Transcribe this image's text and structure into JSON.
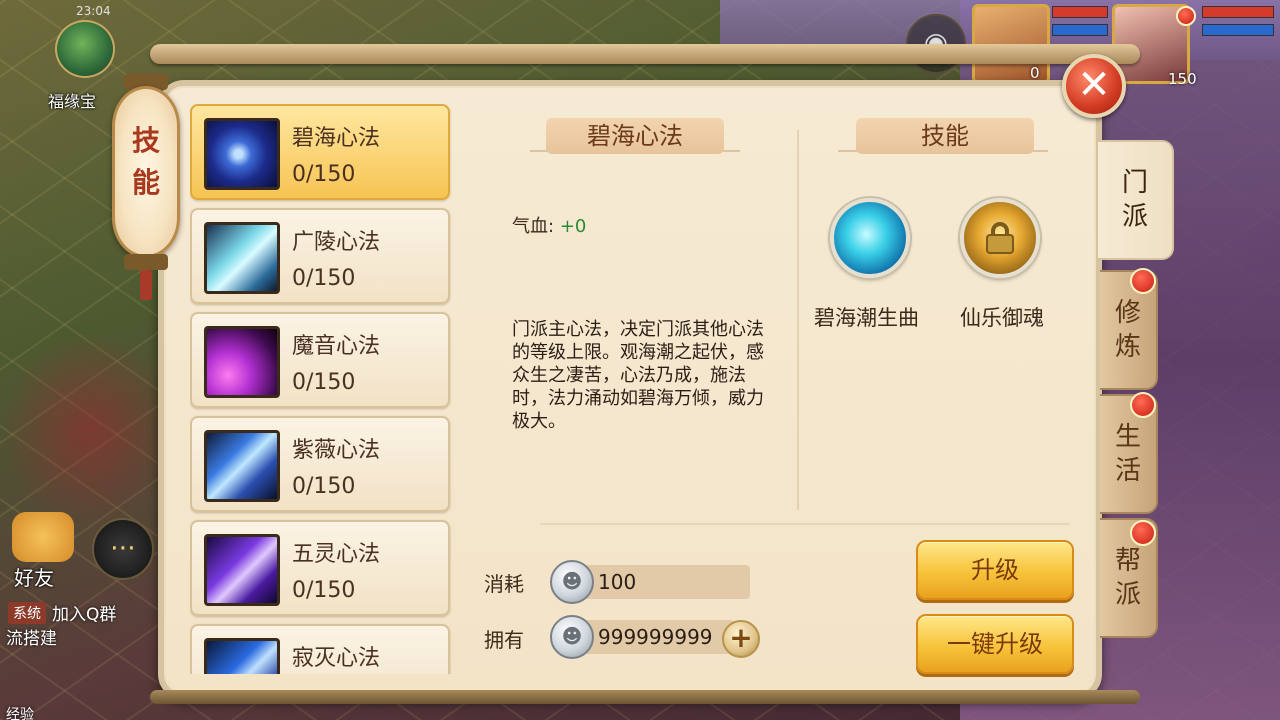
{
  "hud": {
    "status_time": "23:04",
    "fortune_label": "福缘宝",
    "friend_label": "好友",
    "chat_tag": "系统",
    "chat_text": "加入Q群",
    "chat_text2": "流搭建",
    "exp_label": "经验",
    "player_level_1": "0",
    "player_level_2": "150"
  },
  "panel": {
    "lantern_title": "技能",
    "close_symbol": "✕"
  },
  "skills": [
    {
      "name": "碧海心法",
      "level": "0/150",
      "icon": "wave-swirl-icon",
      "selected": true
    },
    {
      "name": "广陵心法",
      "level": "0/150",
      "icon": "ice-crystal-icon"
    },
    {
      "name": "魔音心法",
      "level": "0/150",
      "icon": "purple-lightning-icon"
    },
    {
      "name": "紫薇心法",
      "level": "0/150",
      "icon": "blue-claw-icon"
    },
    {
      "name": "五灵心法",
      "level": "0/150",
      "icon": "violet-burst-icon"
    },
    {
      "name": "寂灭心法",
      "level": "",
      "icon": "blue-slash-icon"
    }
  ],
  "detail": {
    "title": "碧海心法",
    "attr_label": "气血:",
    "attr_value": "+0",
    "description": "门派主心法，决定门派其他心法的等级上限。观海潮之起伏，感众生之凄苦，心法乃成，施法时，法力涌动如碧海万倾，威力极大。"
  },
  "related": {
    "title": "技能",
    "items": [
      {
        "name": "碧海潮生曲",
        "icon": "wave-music-icon"
      },
      {
        "name": "仙乐御魂",
        "icon": "lock-icon"
      }
    ]
  },
  "cost": {
    "consume_label": "消耗",
    "consume_value": "100",
    "own_label": "拥有",
    "own_value": "999999999",
    "coin_icon": "silver-coin-icon"
  },
  "buttons": {
    "upgrade": "升级",
    "upgrade_all": "一键升级"
  },
  "tabs": [
    {
      "label": "门派",
      "active": true,
      "dot": false
    },
    {
      "label": "修炼",
      "dot": true
    },
    {
      "label": "生活",
      "dot": true
    },
    {
      "label": "帮派",
      "dot": true
    }
  ],
  "colors": {
    "selected_item": "#f7c453",
    "button_gold": "#f7c33a",
    "attr_green": "#2e8a2e",
    "alert_red": "#c81e12"
  }
}
